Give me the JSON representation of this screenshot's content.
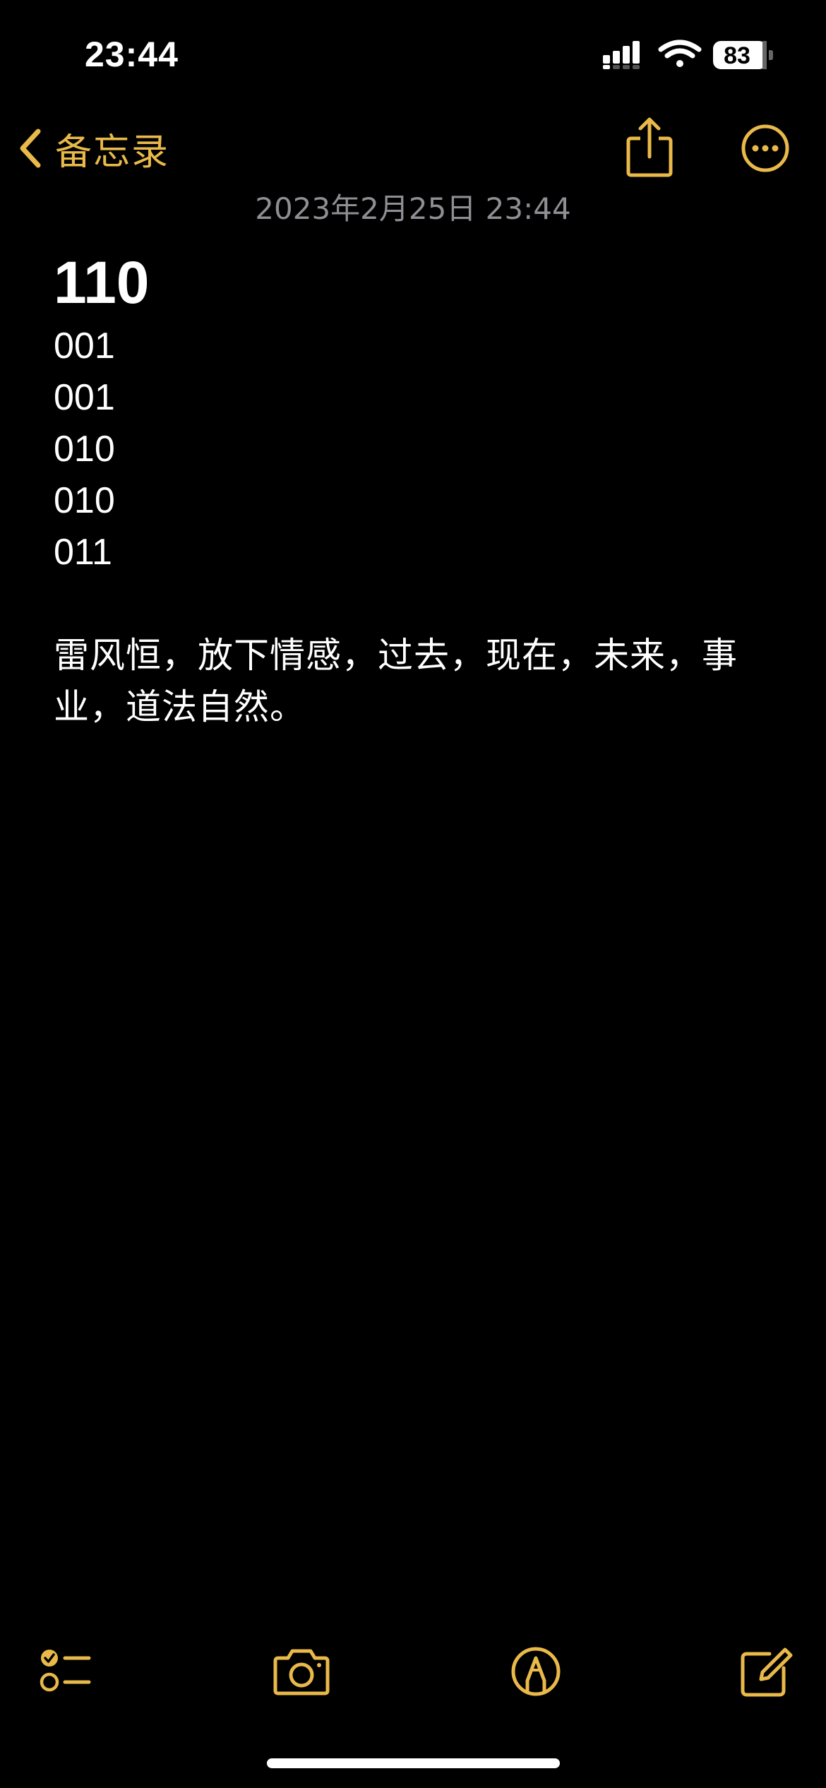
{
  "colors": {
    "accent": "#E9B949",
    "background": "#000000",
    "text": "#FFFFFF",
    "secondary_text": "#8E8E93"
  },
  "status_bar": {
    "time": "23:44",
    "battery_percent": "83",
    "icons": [
      "signal-icon",
      "wifi-icon",
      "battery-icon"
    ]
  },
  "nav": {
    "back_label": "备忘录",
    "icons": [
      "chevron-left-icon",
      "share-icon",
      "more-icon"
    ]
  },
  "note": {
    "date": "2023年2月25日 23:44",
    "title": "110",
    "lines": [
      "001",
      "001",
      "010",
      "010",
      "011"
    ],
    "paragraph_line1": "雷风恒，放下情感，过去，现在，未来，事",
    "paragraph_line2": "业，道法自然。"
  },
  "toolbar": {
    "icons": [
      "checklist-icon",
      "camera-icon",
      "markup-icon",
      "compose-icon"
    ]
  }
}
